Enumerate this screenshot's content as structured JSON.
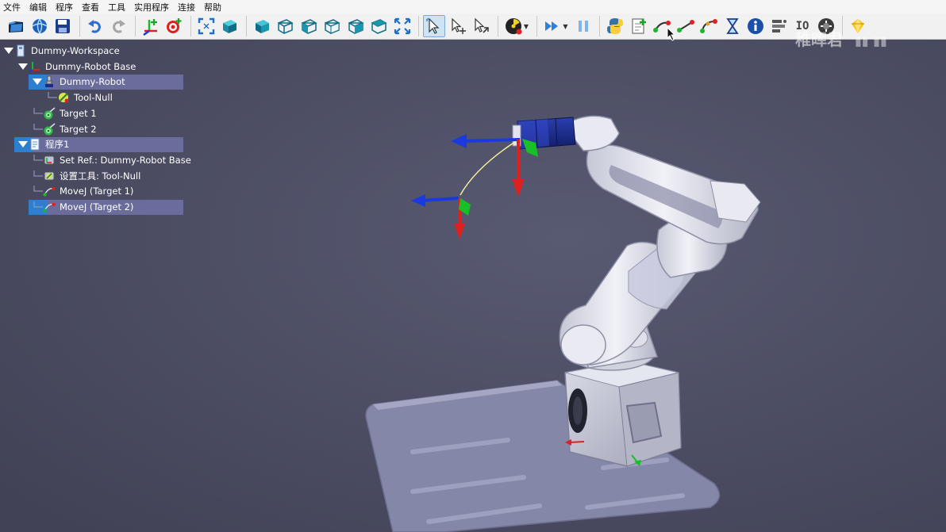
{
  "menu": [
    "文件",
    "编辑",
    "程序",
    "查看",
    "工具",
    "实用程序",
    "连接",
    "帮助"
  ],
  "toolbar": {
    "groups": [
      [
        {
          "name": "open-station-icon"
        },
        {
          "name": "online-library-icon"
        },
        {
          "name": "save-icon"
        }
      ],
      [
        {
          "name": "undo-icon"
        },
        {
          "name": "redo-icon"
        }
      ],
      [
        {
          "name": "add-reference-frame-icon"
        },
        {
          "name": "add-target-icon"
        }
      ],
      [
        {
          "name": "fit-all-icon"
        },
        {
          "name": "isometric-view-icon"
        }
      ],
      [
        {
          "name": "view-front-icon"
        },
        {
          "name": "view-back-icon"
        },
        {
          "name": "view-left-icon"
        },
        {
          "name": "view-right-icon"
        },
        {
          "name": "view-top-icon"
        },
        {
          "name": "view-bottom-icon"
        },
        {
          "name": "fullscreen-icon"
        }
      ],
      [
        {
          "name": "select-icon",
          "active": true
        },
        {
          "name": "move-reference-icon"
        },
        {
          "name": "move-object-icon"
        }
      ],
      [
        {
          "name": "collision-check-icon",
          "dropdown": true
        }
      ],
      [
        {
          "name": "run-program-icon",
          "dropdown": true
        },
        {
          "name": "pause-icon"
        }
      ],
      [
        {
          "name": "python-script-icon"
        },
        {
          "name": "add-program-icon"
        },
        {
          "name": "movej-icon"
        },
        {
          "name": "movel-icon"
        },
        {
          "name": "movec-icon"
        },
        {
          "name": "pause-wait-icon"
        },
        {
          "name": "info-icon"
        },
        {
          "name": "set-io-icon"
        },
        {
          "name": "io-icon",
          "text": "IO"
        },
        {
          "name": "call-program-icon"
        }
      ],
      [
        {
          "name": "gem-icon"
        }
      ]
    ]
  },
  "tree": [
    {
      "id": "workspace",
      "label": "Dummy-Workspace",
      "level": 0,
      "expand": "open",
      "icon": "station-icon"
    },
    {
      "id": "robot-base",
      "label": "Dummy-Robot Base",
      "level": 1,
      "expand": "open",
      "icon": "reference-frame-icon"
    },
    {
      "id": "robot",
      "label": "Dummy-Robot",
      "level": 2,
      "expand": "open",
      "icon": "robot-icon",
      "selected": true
    },
    {
      "id": "tool-null",
      "label": "Tool-Null",
      "level": 3,
      "expand": "none",
      "icon": "tool-icon"
    },
    {
      "id": "target-1",
      "label": "Target 1",
      "level": 2,
      "expand": "none",
      "icon": "target-icon"
    },
    {
      "id": "target-2",
      "label": "Target 2",
      "level": 2,
      "expand": "none",
      "icon": "target-icon"
    },
    {
      "id": "program-1",
      "label": "程序1",
      "level": 1,
      "expand": "open",
      "icon": "program-icon",
      "selected": true
    },
    {
      "id": "set-ref",
      "label": "Set Ref.: Dummy-Robot Base",
      "level": 2,
      "expand": "none",
      "icon": "set-reference-icon"
    },
    {
      "id": "set-tool",
      "label": "设置工具: Tool-Null",
      "level": 2,
      "expand": "none",
      "icon": "set-tool-icon"
    },
    {
      "id": "movej-1",
      "label": "MoveJ (Target 1)",
      "level": 2,
      "expand": "none",
      "icon": "movej-icon"
    },
    {
      "id": "movej-2",
      "label": "MoveJ (Target 2)",
      "level": 2,
      "expand": "none",
      "icon": "movej-icon",
      "selected": true
    }
  ],
  "viewport": {
    "width": 1192,
    "height": 621
  },
  "colors": {
    "background": "#4d4f64",
    "selection": "#6a6d9c",
    "selection_accent": "#2f7fd0",
    "axis_x": "#e02020",
    "axis_z": "#1a3adf",
    "axis_y": "#16c026",
    "robot": "#e6e8f0",
    "motor": "#1b2a8a",
    "platform": "#8a8cae"
  },
  "watermark": "稚晖君"
}
